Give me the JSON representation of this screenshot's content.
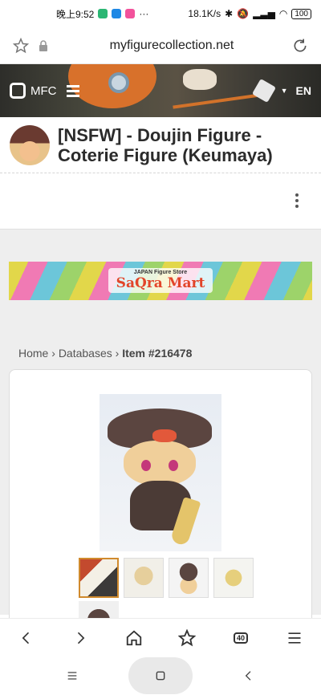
{
  "status_bar": {
    "time": "晚上9:52",
    "more": "···",
    "speed": "18.1K/s",
    "battery": "100",
    "app_colors": [
      "#2bb673",
      "#1e88e5",
      "#f2529b"
    ]
  },
  "browser": {
    "url": "myfigurecollection.net",
    "bookmark_icon": "star-outline-icon",
    "secure_icon": "lock-icon",
    "reload_icon": "reload-icon"
  },
  "site_header": {
    "logo_text": "MFC",
    "language": "EN",
    "menu_icon": "hamburger-icon",
    "user_icon": "cube-icon"
  },
  "item": {
    "title": "[NSFW] - Doujin Figure - Coterie Figure (Keumaya)"
  },
  "banner": {
    "small_text": "JAPAN Figure Store",
    "brand": "SaQra Mart"
  },
  "breadcrumb": {
    "home": "Home",
    "sep1": "›",
    "databases": "Databases",
    "sep2": "›",
    "item": "Item #216478"
  },
  "bottom_nav": {
    "tab_count": "40"
  },
  "colors": {
    "accent_orange": "#d8712b",
    "banner_red": "#e2452a",
    "page_bg": "#eeeeee"
  }
}
